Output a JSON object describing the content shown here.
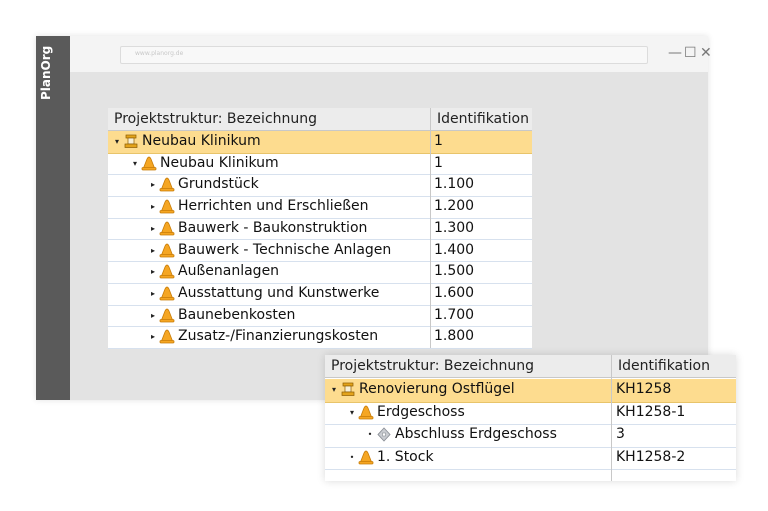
{
  "app": {
    "logo": "PlanOrg",
    "address": "www.planorg.de"
  },
  "window_controls": {
    "minimize": "—",
    "maximize": "☐",
    "close": "✕"
  },
  "tree1": {
    "col1": "Projektstruktur: Bezeichnung",
    "col2": "Identifikation",
    "rows": [
      {
        "label": "Neubau Klinikum",
        "id": "1",
        "icon": "project-icon",
        "selected": true
      },
      {
        "label": "Neubau Klinikum",
        "id": "1",
        "icon": "cone-icon"
      },
      {
        "label": "Grundstück",
        "id": "1.100",
        "icon": "cone-icon"
      },
      {
        "label": "Herrichten und Erschließen",
        "id": "1.200",
        "icon": "cone-icon"
      },
      {
        "label": "Bauwerk - Baukonstruktion",
        "id": "1.300",
        "icon": "cone-icon"
      },
      {
        "label": "Bauwerk - Technische Anlagen",
        "id": "1.400",
        "icon": "cone-icon"
      },
      {
        "label": "Außenanlagen",
        "id": "1.500",
        "icon": "cone-icon"
      },
      {
        "label": "Ausstattung und Kunstwerke",
        "id": "1.600",
        "icon": "cone-icon"
      },
      {
        "label": "Baunebenkosten",
        "id": "1.700",
        "icon": "cone-icon"
      },
      {
        "label": "Zusatz-/Finanzierungskosten",
        "id": "1.800",
        "icon": "cone-icon"
      }
    ]
  },
  "tree2": {
    "col1": "Projektstruktur: Bezeichnung",
    "col2": "Identifikation",
    "rows": [
      {
        "label": "Renovierung Ostflügel",
        "id": "KH1258",
        "icon": "project-icon",
        "selected": true
      },
      {
        "label": "Erdgeschoss",
        "id": "KH1258-1",
        "icon": "cone-icon"
      },
      {
        "label": "Abschluss Erdgeschoss",
        "id": "3",
        "icon": "milestone-icon"
      },
      {
        "label": "1. Stock",
        "id": "KH1258-2",
        "icon": "cone-icon"
      }
    ]
  },
  "colors": {
    "selected_row": "#fddc8f",
    "cone": "#f5a623",
    "sidebar": "#5a5a5a"
  }
}
